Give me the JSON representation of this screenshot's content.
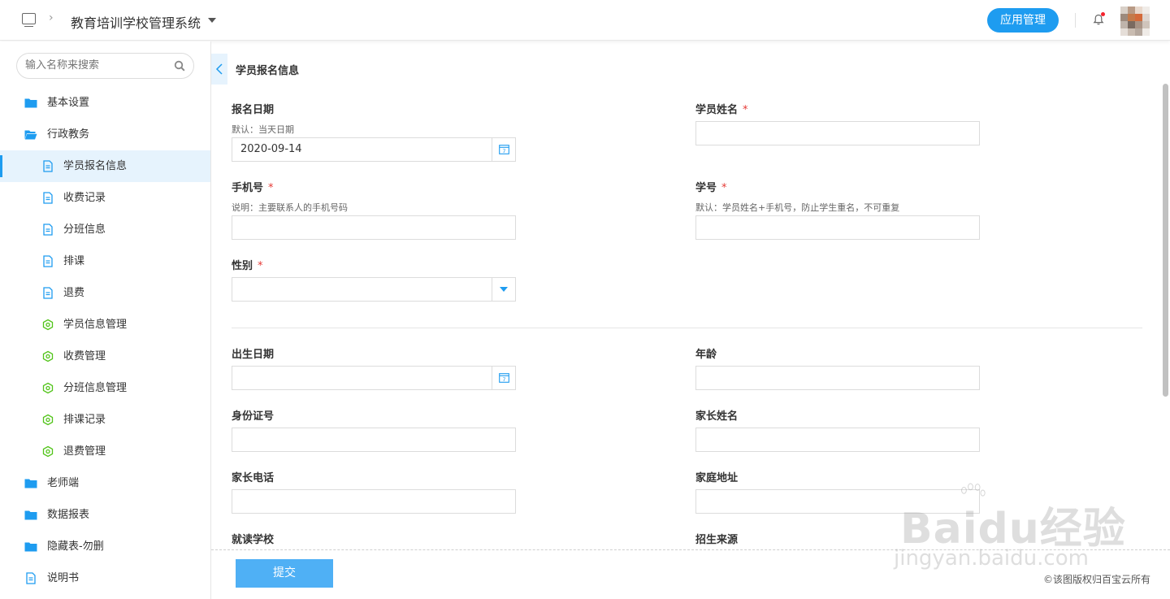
{
  "header": {
    "system_title": "教育培训学校管理系统",
    "app_button": "应用管理"
  },
  "sidebar": {
    "search_placeholder": "输入名称来搜索",
    "items": [
      {
        "label": "基本设置",
        "icon": "folder-icon",
        "level": 1
      },
      {
        "label": "行政教务",
        "icon": "folder-open-icon",
        "level": 1
      },
      {
        "label": "学员报名信息",
        "icon": "document-icon",
        "level": 2,
        "selected": true
      },
      {
        "label": "收费记录",
        "icon": "document-icon",
        "level": 2
      },
      {
        "label": "分班信息",
        "icon": "document-icon",
        "level": 2
      },
      {
        "label": "排课",
        "icon": "document-icon",
        "level": 2
      },
      {
        "label": "退费",
        "icon": "document-icon",
        "level": 2
      },
      {
        "label": "学员信息管理",
        "icon": "gear-icon",
        "level": 2
      },
      {
        "label": "收费管理",
        "icon": "gear-icon",
        "level": 2
      },
      {
        "label": "分班信息管理",
        "icon": "gear-icon",
        "level": 2
      },
      {
        "label": "排课记录",
        "icon": "gear-icon",
        "level": 2
      },
      {
        "label": "退费管理",
        "icon": "gear-icon",
        "level": 2
      },
      {
        "label": "老师端",
        "icon": "folder-icon",
        "level": 1
      },
      {
        "label": "数据报表",
        "icon": "folder-icon",
        "level": 1
      },
      {
        "label": "隐藏表-勿删",
        "icon": "folder-icon",
        "level": 1
      },
      {
        "label": "说明书",
        "icon": "document-icon",
        "level": 1
      }
    ]
  },
  "form": {
    "title": "学员报名信息",
    "required_mark": "*",
    "fields": {
      "signup_date": {
        "label": "报名日期",
        "help": "默认：当天日期",
        "value": "2020-09-14"
      },
      "student_name": {
        "label": "学员姓名",
        "value": ""
      },
      "phone": {
        "label": "手机号",
        "help": "说明：主要联系人的手机号码",
        "value": ""
      },
      "student_id": {
        "label": "学号",
        "help": "默认：学员姓名+手机号，防止学生重名，不可重复",
        "value": ""
      },
      "gender": {
        "label": "性别",
        "value": ""
      },
      "birth_date": {
        "label": "出生日期",
        "value": ""
      },
      "age": {
        "label": "年龄",
        "value": ""
      },
      "id_number": {
        "label": "身份证号",
        "value": ""
      },
      "parent_name": {
        "label": "家长姓名",
        "value": ""
      },
      "parent_phone": {
        "label": "家长电话",
        "value": ""
      },
      "home_address": {
        "label": "家庭地址",
        "value": ""
      },
      "school": {
        "label": "就读学校",
        "value": ""
      },
      "source": {
        "label": "招生来源",
        "value": ""
      }
    },
    "submit_label": "提交"
  },
  "watermark": {
    "brand": "Baidu经验",
    "url": "jingyan.baidu.com",
    "copyright": "©该图版权归百宝云所有"
  },
  "colors": {
    "accent": "#1e9cf0",
    "required": "#e53935",
    "selected_bg": "#e6f3fd"
  }
}
